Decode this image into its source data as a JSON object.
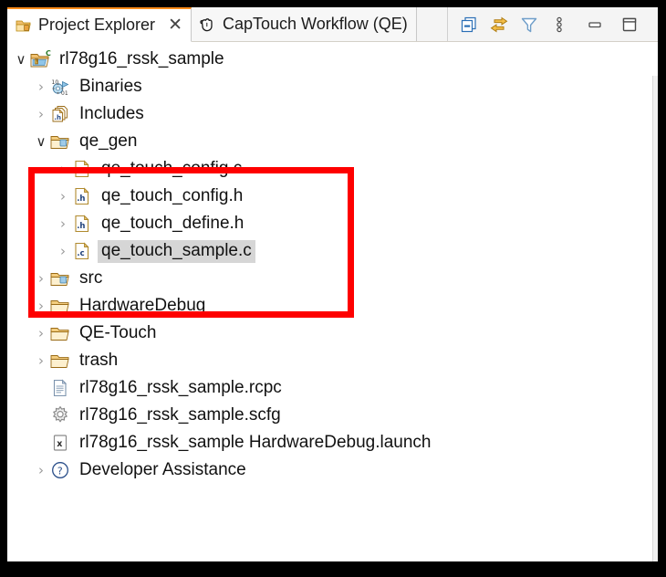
{
  "window": {
    "frame_color": "#000000",
    "background": "#ffffff"
  },
  "tabs": [
    {
      "label": "Project Explorer",
      "icon": "project-explorer-icon",
      "active": true,
      "closable": true,
      "close_glyph": "✕"
    },
    {
      "label": "CapTouch Workflow (QE)",
      "icon": "captouch-hand-icon",
      "active": false,
      "closable": false,
      "close_glyph": ""
    }
  ],
  "view_toolbar": [
    {
      "name": "collapse-all-icon",
      "tooltip": "Collapse All"
    },
    {
      "name": "link-with-editor-icon",
      "tooltip": "Link with Editor"
    },
    {
      "name": "filter-icon",
      "tooltip": "View Menu Filters"
    },
    {
      "name": "view-menu-icon",
      "tooltip": "View Menu"
    }
  ],
  "window_buttons": [
    {
      "name": "minimize-icon",
      "tooltip": "Minimize"
    },
    {
      "name": "maximize-icon",
      "tooltip": "Maximize"
    }
  ],
  "tree": [
    {
      "label": "rl78g16_rssk_sample",
      "level": 0,
      "state": "open",
      "icon": "c-project-icon",
      "selected": false
    },
    {
      "label": "Binaries",
      "level": 1,
      "state": "collapsed",
      "icon": "binaries-icon",
      "selected": false
    },
    {
      "label": "Includes",
      "level": 1,
      "state": "collapsed",
      "icon": "includes-icon",
      "selected": false
    },
    {
      "label": "qe_gen",
      "level": 1,
      "state": "open",
      "icon": "source-folder-icon",
      "selected": false
    },
    {
      "label": "qe_touch_config.c",
      "level": 2,
      "state": "collapsed",
      "icon": "c-file-icon",
      "selected": false
    },
    {
      "label": "qe_touch_config.h",
      "level": 2,
      "state": "collapsed",
      "icon": "h-file-icon",
      "selected": false
    },
    {
      "label": "qe_touch_define.h",
      "level": 2,
      "state": "collapsed",
      "icon": "h-file-icon",
      "selected": false
    },
    {
      "label": "qe_touch_sample.c",
      "level": 2,
      "state": "collapsed",
      "icon": "c-file-icon",
      "selected": true
    },
    {
      "label": "src",
      "level": 1,
      "state": "collapsed",
      "icon": "source-folder-icon",
      "selected": false
    },
    {
      "label": "HardwareDebug",
      "level": 1,
      "state": "collapsed",
      "icon": "folder-icon",
      "selected": false
    },
    {
      "label": "QE-Touch",
      "level": 1,
      "state": "collapsed",
      "icon": "folder-icon",
      "selected": false
    },
    {
      "label": "trash",
      "level": 1,
      "state": "collapsed",
      "icon": "folder-icon",
      "selected": false
    },
    {
      "label": "rl78g16_rssk_sample.rcpc",
      "level": 1,
      "state": "none",
      "icon": "document-icon",
      "selected": false
    },
    {
      "label": "rl78g16_rssk_sample.scfg",
      "level": 1,
      "state": "none",
      "icon": "gear-icon",
      "selected": false
    },
    {
      "label": "rl78g16_rssk_sample HardwareDebug.launch",
      "level": 1,
      "state": "none",
      "icon": "launch-icon",
      "selected": false
    },
    {
      "label": "Developer Assistance",
      "level": 1,
      "state": "collapsed",
      "icon": "question-icon",
      "selected": false
    }
  ],
  "annotation": {
    "name": "red-highlight-rectangle",
    "color": "#fe0000",
    "covers": [
      "qe_gen",
      "qe_touch_config.c",
      "qe_touch_config.h",
      "qe_touch_define.h",
      "qe_touch_sample.c"
    ]
  },
  "glyphs": {
    "twisty_collapsed": "›",
    "twisty_open": "∨"
  }
}
